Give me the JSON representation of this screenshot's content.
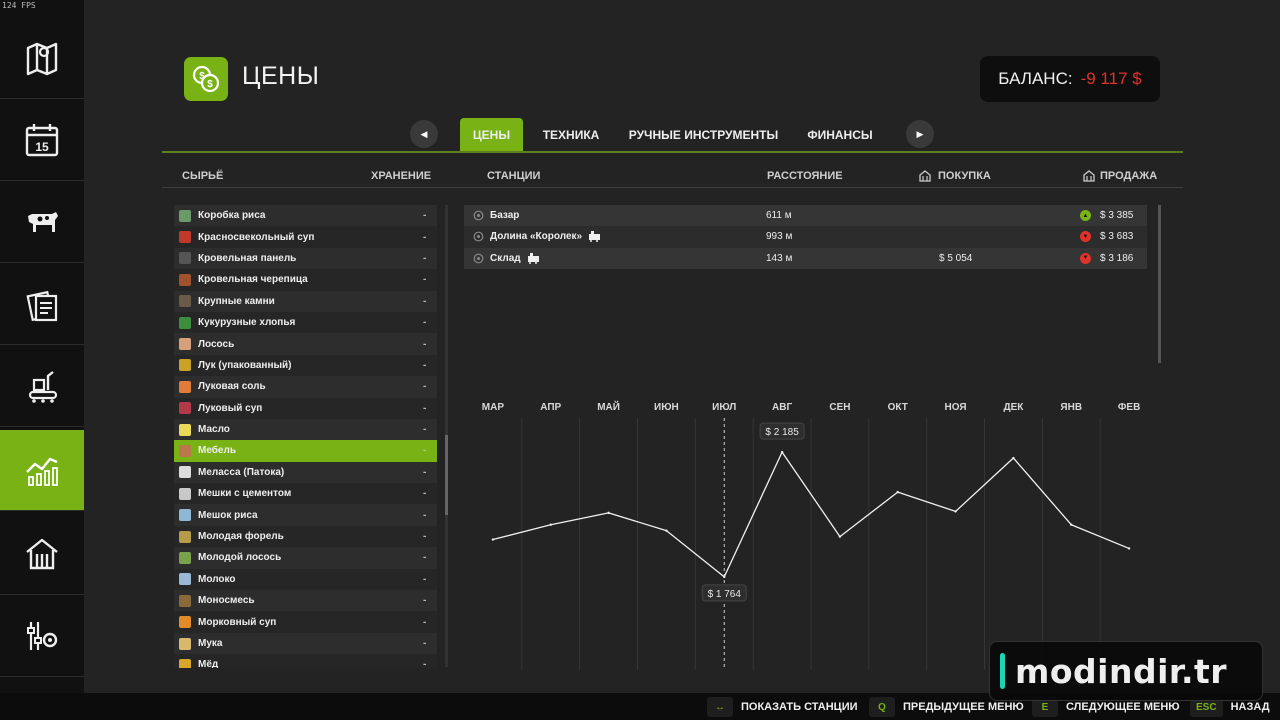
{
  "hud": {
    "fps": "124 FPS"
  },
  "sidebar": {
    "items": [
      {
        "icon": "map-icon"
      },
      {
        "icon": "calendar-icon",
        "day": "15"
      },
      {
        "icon": "cow-icon"
      },
      {
        "icon": "contracts-icon"
      },
      {
        "icon": "production-icon"
      },
      {
        "icon": "prices-chart-icon",
        "active": true
      },
      {
        "icon": "barn-icon"
      },
      {
        "icon": "settings-icon"
      }
    ]
  },
  "page": {
    "title": "ЦЕНЫ",
    "icon": "coins-icon"
  },
  "balance": {
    "label": "БАЛАНС:",
    "value": "-9 117 $"
  },
  "tabs": [
    {
      "label": "ЦЕНЫ",
      "active": true
    },
    {
      "label": "ТЕХНИКА"
    },
    {
      "label": "РУЧНЫЕ ИНСТРУМЕНТЫ"
    },
    {
      "label": "ФИНАНСЫ"
    }
  ],
  "columns": {
    "raw": "СЫРЬЁ",
    "storage": "ХРАНЕНИЕ",
    "stations": "СТАНЦИИ",
    "distance": "РАССТОЯНИЕ",
    "buy": "ПОКУПКА",
    "sell": "ПРОДАЖА"
  },
  "products": [
    {
      "name": "Коробка риса",
      "storage": "-",
      "color": "#6a9a6a"
    },
    {
      "name": "Красносвекольный суп",
      "storage": "-",
      "color": "#c0392b"
    },
    {
      "name": "Кровельная панель",
      "storage": "-",
      "color": "#555"
    },
    {
      "name": "Кровельная черепица",
      "storage": "-",
      "color": "#a0522d"
    },
    {
      "name": "Крупные камни",
      "storage": "-",
      "color": "#6b5a48"
    },
    {
      "name": "Кукурузные хлопья",
      "storage": "-",
      "color": "#3c8d3c"
    },
    {
      "name": "Лосось",
      "storage": "-",
      "color": "#d5a07a"
    },
    {
      "name": "Лук (упакованный)",
      "storage": "-",
      "color": "#c9a227"
    },
    {
      "name": "Луковая соль",
      "storage": "-",
      "color": "#e07b39"
    },
    {
      "name": "Луковый суп",
      "storage": "-",
      "color": "#b03a48"
    },
    {
      "name": "Масло",
      "storage": "-",
      "color": "#e8d95a"
    },
    {
      "name": "Мебель",
      "storage": "-",
      "color": "#b9794a",
      "selected": true
    },
    {
      "name": "Меласса (Патока)",
      "storage": "-",
      "color": "#dddddd"
    },
    {
      "name": "Мешки с цементом",
      "storage": "-",
      "color": "#c8c8c8"
    },
    {
      "name": "Мешок риса",
      "storage": "-",
      "color": "#8fb8d6"
    },
    {
      "name": "Молодая форель",
      "storage": "-",
      "color": "#b59a4a"
    },
    {
      "name": "Молодой лосось",
      "storage": "-",
      "color": "#7aa24a"
    },
    {
      "name": "Молоко",
      "storage": "-",
      "color": "#9ab8d6"
    },
    {
      "name": "Моносмесь",
      "storage": "-",
      "color": "#8a6a3a"
    },
    {
      "name": "Морковный суп",
      "storage": "-",
      "color": "#e08a2a"
    },
    {
      "name": "Мука",
      "storage": "-",
      "color": "#d8b86a"
    },
    {
      "name": "Мёд",
      "storage": "-",
      "color": "#d8a62a"
    }
  ],
  "stations": [
    {
      "name": "Базар",
      "distance": "611 м",
      "buy": "",
      "sell": "$ 3 385",
      "trend": "up",
      "trend_color": "#79b215",
      "icon_extra": ""
    },
    {
      "name": "Долина «Королек»",
      "distance": "993 м",
      "buy": "",
      "sell": "$ 3 683",
      "trend": "down",
      "trend_color": "#e0322b",
      "icon_extra": "train-icon"
    },
    {
      "name": "Склад",
      "distance": "143 м",
      "buy": "$ 5 054",
      "sell": "$ 3 186",
      "trend": "down",
      "trend_color": "#e0322b",
      "icon_extra": "factory-icon"
    }
  ],
  "chart_data": {
    "type": "line",
    "categories": [
      "МАР",
      "АПР",
      "МАЙ",
      "ИЮН",
      "ИЮЛ",
      "АВГ",
      "СЕН",
      "ОКТ",
      "НОЯ",
      "ДЕК",
      "ЯНВ",
      "ФЕВ"
    ],
    "values": [
      1890,
      1940,
      1980,
      1920,
      1764,
      2185,
      1900,
      2050,
      1985,
      2165,
      1940,
      1860
    ],
    "ylim": [
      1450,
      2300
    ],
    "current_month_index": 4,
    "annotations": [
      {
        "label": "$ 2 185",
        "index": 5
      },
      {
        "label": "$ 1 764",
        "index": 4
      }
    ],
    "title": "",
    "xlabel": "",
    "ylabel": "",
    "grid": true
  },
  "bottom_bar": [
    {
      "key": "↔",
      "label": "ПОКАЗАТЬ СТАНЦИИ"
    },
    {
      "key": "Q",
      "label": "ПРЕДЫДУЩЕЕ МЕНЮ"
    },
    {
      "key": "E",
      "label": "СЛЕДУЮЩЕЕ МЕНЮ"
    },
    {
      "key": "ESC",
      "label": "НАЗАД"
    }
  ],
  "watermark": "modindir.tr",
  "colors": {
    "accent": "#79b215",
    "negative": "#e0322b"
  }
}
